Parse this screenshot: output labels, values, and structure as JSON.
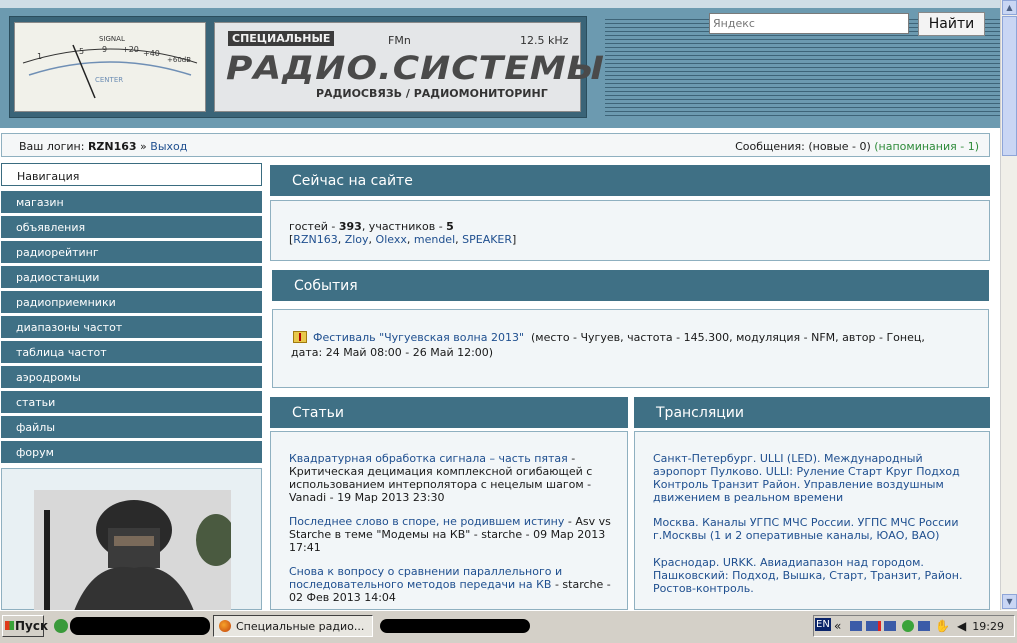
{
  "header": {
    "meter": {
      "signal_label": "SIGNAL",
      "scale": [
        "1",
        "5",
        "9",
        "+20",
        "+40",
        "+60dB"
      ],
      "center_label": "CENTER"
    },
    "logo": {
      "top_label": "СПЕЦИАЛЬНЫЕ",
      "fm_label": "FMn",
      "khz_label": "12.5 kHz",
      "title": "РАДИО.СИСТЕМЫ",
      "subtitle": "РАДИОСВЯЗЬ / РАДИОМОНИТОРИНГ"
    },
    "search": {
      "placeholder": "Яндекс",
      "button": "Найти"
    }
  },
  "login_bar": {
    "prefix": "Ваш логин: ",
    "username": "RZN163",
    "separator": " » ",
    "logout": "Выход",
    "messages_label": "Сообщения: (новые - 0) ",
    "reminders": "(напоминания - 1)"
  },
  "sidebar": {
    "heading": "Навигация",
    "items": [
      "магазин",
      "объявления",
      "радиорейтинг",
      "радиостанции",
      "радиоприемники",
      "диапазоны частот",
      "таблица частот",
      "аэродромы",
      "статьи",
      "файлы",
      "форум"
    ]
  },
  "online": {
    "title": "Сейчас на сайте",
    "guests_label": "гостей - ",
    "guests": "393",
    "members_label": ", участников - ",
    "members": "5",
    "users": [
      "RZN163",
      "Zloy",
      "Olexx",
      "mendel",
      "SPEAKER"
    ]
  },
  "events": {
    "title": "События",
    "link": "Фестиваль \"Чугуевская волна 2013\"",
    "details_line1": "(место - Чугуев, частота - 145.300, модуляция - NFM, автор - Гонец,",
    "details_line2": "дата: 24 Май 08:00 - 26 Май 12:00)"
  },
  "articles": {
    "title": "Статьи",
    "items": [
      {
        "link": "Квадратурная обработка сигнала – часть пятая",
        "rest": " - Критическая децимация комплексной огибающей с использованием интерполятора с нецелым шагом - Vanadi - 19 Мар 2013 23:30"
      },
      {
        "link": "Последнее слово в споре, не родившем истину",
        "rest": " - Asv vs Starche в теме \"Модемы на КВ\" - starche - 09 Мар 2013 17:41"
      },
      {
        "link": "Снова к вопросу о сравнении параллельного и последовательного методов передачи на КВ",
        "rest": " - starche - 02 Фев 2013 14:04"
      }
    ]
  },
  "broadcasts": {
    "title": "Трансляции",
    "items": [
      "Санкт-Петербург. ULLI (LED). Международный аэропорт Пулково. ULLI: Руление Старт Круг Подход Контроль Транзит Район. Управление воздушным движением в реальном времени",
      "Москва. Каналы УГПС МЧС России. УГПС МЧС России г.Москвы (1 и 2 оперативные каналы, ЮАО, ВАО)",
      "Краснодар. URKK. Авиадиапазон над городом. Пашковский: Подход, Вышка, Старт, Транзит, Район. Ростов-контроль."
    ]
  },
  "taskbar": {
    "start": "Пуск",
    "active_window": "Специальные радио...",
    "lang": "EN",
    "time": "19:29"
  }
}
